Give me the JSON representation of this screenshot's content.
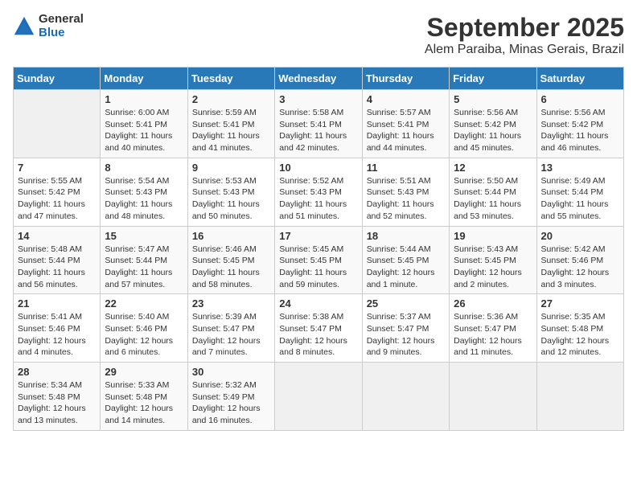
{
  "header": {
    "logo": {
      "general": "General",
      "blue": "Blue"
    },
    "title": "September 2025",
    "subtitle": "Alem Paraiba, Minas Gerais, Brazil"
  },
  "weekdays": [
    "Sunday",
    "Monday",
    "Tuesday",
    "Wednesday",
    "Thursday",
    "Friday",
    "Saturday"
  ],
  "weeks": [
    [
      {
        "day": "",
        "empty": true
      },
      {
        "day": "1",
        "sunrise": "6:00 AM",
        "sunset": "5:41 PM",
        "daylight": "11 hours and 40 minutes."
      },
      {
        "day": "2",
        "sunrise": "5:59 AM",
        "sunset": "5:41 PM",
        "daylight": "11 hours and 41 minutes."
      },
      {
        "day": "3",
        "sunrise": "5:58 AM",
        "sunset": "5:41 PM",
        "daylight": "11 hours and 42 minutes."
      },
      {
        "day": "4",
        "sunrise": "5:57 AM",
        "sunset": "5:41 PM",
        "daylight": "11 hours and 44 minutes."
      },
      {
        "day": "5",
        "sunrise": "5:56 AM",
        "sunset": "5:42 PM",
        "daylight": "11 hours and 45 minutes."
      },
      {
        "day": "6",
        "sunrise": "5:56 AM",
        "sunset": "5:42 PM",
        "daylight": "11 hours and 46 minutes."
      }
    ],
    [
      {
        "day": "7",
        "sunrise": "5:55 AM",
        "sunset": "5:42 PM",
        "daylight": "11 hours and 47 minutes."
      },
      {
        "day": "8",
        "sunrise": "5:54 AM",
        "sunset": "5:43 PM",
        "daylight": "11 hours and 48 minutes."
      },
      {
        "day": "9",
        "sunrise": "5:53 AM",
        "sunset": "5:43 PM",
        "daylight": "11 hours and 50 minutes."
      },
      {
        "day": "10",
        "sunrise": "5:52 AM",
        "sunset": "5:43 PM",
        "daylight": "11 hours and 51 minutes."
      },
      {
        "day": "11",
        "sunrise": "5:51 AM",
        "sunset": "5:43 PM",
        "daylight": "11 hours and 52 minutes."
      },
      {
        "day": "12",
        "sunrise": "5:50 AM",
        "sunset": "5:44 PM",
        "daylight": "11 hours and 53 minutes."
      },
      {
        "day": "13",
        "sunrise": "5:49 AM",
        "sunset": "5:44 PM",
        "daylight": "11 hours and 55 minutes."
      }
    ],
    [
      {
        "day": "14",
        "sunrise": "5:48 AM",
        "sunset": "5:44 PM",
        "daylight": "11 hours and 56 minutes."
      },
      {
        "day": "15",
        "sunrise": "5:47 AM",
        "sunset": "5:44 PM",
        "daylight": "11 hours and 57 minutes."
      },
      {
        "day": "16",
        "sunrise": "5:46 AM",
        "sunset": "5:45 PM",
        "daylight": "11 hours and 58 minutes."
      },
      {
        "day": "17",
        "sunrise": "5:45 AM",
        "sunset": "5:45 PM",
        "daylight": "11 hours and 59 minutes."
      },
      {
        "day": "18",
        "sunrise": "5:44 AM",
        "sunset": "5:45 PM",
        "daylight": "12 hours and 1 minute."
      },
      {
        "day": "19",
        "sunrise": "5:43 AM",
        "sunset": "5:45 PM",
        "daylight": "12 hours and 2 minutes."
      },
      {
        "day": "20",
        "sunrise": "5:42 AM",
        "sunset": "5:46 PM",
        "daylight": "12 hours and 3 minutes."
      }
    ],
    [
      {
        "day": "21",
        "sunrise": "5:41 AM",
        "sunset": "5:46 PM",
        "daylight": "12 hours and 4 minutes."
      },
      {
        "day": "22",
        "sunrise": "5:40 AM",
        "sunset": "5:46 PM",
        "daylight": "12 hours and 6 minutes."
      },
      {
        "day": "23",
        "sunrise": "5:39 AM",
        "sunset": "5:47 PM",
        "daylight": "12 hours and 7 minutes."
      },
      {
        "day": "24",
        "sunrise": "5:38 AM",
        "sunset": "5:47 PM",
        "daylight": "12 hours and 8 minutes."
      },
      {
        "day": "25",
        "sunrise": "5:37 AM",
        "sunset": "5:47 PM",
        "daylight": "12 hours and 9 minutes."
      },
      {
        "day": "26",
        "sunrise": "5:36 AM",
        "sunset": "5:47 PM",
        "daylight": "12 hours and 11 minutes."
      },
      {
        "day": "27",
        "sunrise": "5:35 AM",
        "sunset": "5:48 PM",
        "daylight": "12 hours and 12 minutes."
      }
    ],
    [
      {
        "day": "28",
        "sunrise": "5:34 AM",
        "sunset": "5:48 PM",
        "daylight": "12 hours and 13 minutes."
      },
      {
        "day": "29",
        "sunrise": "5:33 AM",
        "sunset": "5:48 PM",
        "daylight": "12 hours and 14 minutes."
      },
      {
        "day": "30",
        "sunrise": "5:32 AM",
        "sunset": "5:49 PM",
        "daylight": "12 hours and 16 minutes."
      },
      {
        "day": "",
        "empty": true
      },
      {
        "day": "",
        "empty": true
      },
      {
        "day": "",
        "empty": true
      },
      {
        "day": "",
        "empty": true
      }
    ]
  ]
}
